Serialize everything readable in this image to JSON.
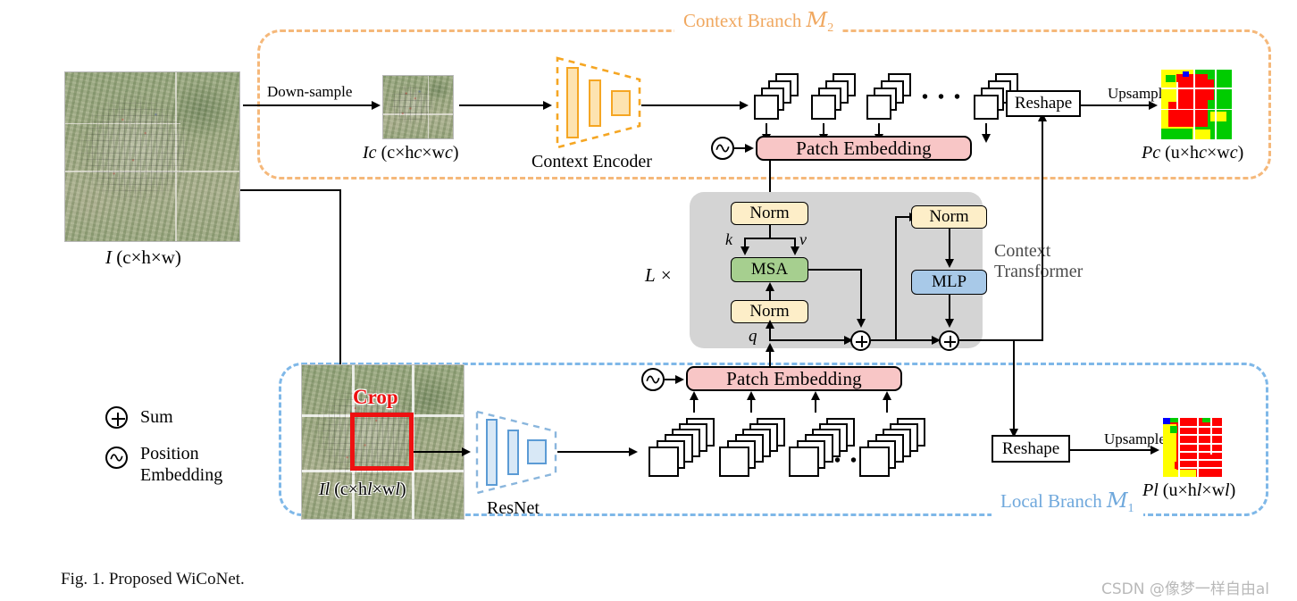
{
  "figure": {
    "caption": "Fig. 1.    Proposed WiCoNet.",
    "watermark": "CSDN @像梦一样自由al"
  },
  "branches": {
    "context": {
      "title_text": "Context Branch ",
      "title_symbol": "M",
      "title_sub": "2",
      "color": "#f0a860"
    },
    "local": {
      "title_text": "Local Branch ",
      "title_symbol": "M",
      "title_sub": "1",
      "color": "#6fa8dc"
    }
  },
  "inputs": {
    "main_image_label": "I (c×h×w)",
    "context_image_label": "I",
    "context_image_sub": "c",
    "context_image_dims": " (c×h",
    "context_image_dims2": "×w",
    "context_image_dims3": ")",
    "local_image_label": "I",
    "local_image_sub": "l",
    "downsample_label": "Down-sample",
    "crop_label": "Crop"
  },
  "encoders": {
    "context_encoder_label": "Context Encoder",
    "resnet_label": "ResNet"
  },
  "modules": {
    "patch_embedding_label": "Patch Embedding",
    "reshape_label": "Reshape",
    "upsample_label": "Upsample",
    "norm_label": "Norm",
    "msa_label": "MSA",
    "mlp_label": "MLP",
    "transformer_label_line1": "Context",
    "transformer_label_line2": "Transformer",
    "repeat_label": "L ×",
    "q_label": "q",
    "k_label": "k",
    "v_label": "v",
    "ellipsis": "• • •"
  },
  "outputs": {
    "context_pred_label": "P",
    "context_pred_sub": "c",
    "context_pred_dims": " (u×h",
    "local_pred_label": "P",
    "local_pred_sub": "l"
  },
  "formulas": {
    "I_main": {
      "sym": "I",
      "rest": " (c×h×w)"
    },
    "I_c": {
      "sym": "I",
      "sub": "c",
      "p1": " (c×h",
      "sub2": "c",
      "p2": "×w",
      "sub3": "c",
      "p3": ")"
    },
    "I_l": {
      "sym": "I",
      "sub": "l",
      "p1": " (c×h",
      "sub2": "l",
      "p2": "×w",
      "sub3": "l",
      "p3": ")"
    },
    "P_c": {
      "sym": "P",
      "sub": "c",
      "p1": " (u×h",
      "sub2": "c",
      "p2": "×w",
      "sub3": "c",
      "p3": ")"
    },
    "P_l": {
      "sym": "P",
      "sub": "l",
      "p1": " (u×h",
      "sub2": "l",
      "p2": "×w",
      "sub3": "l",
      "p3": ")"
    }
  },
  "legend": [
    {
      "icon": "sum-icon",
      "symbol": "+",
      "label": "Sum"
    },
    {
      "icon": "position-embedding-icon",
      "symbol": "~",
      "label_line1": "Position",
      "label_line2": "Embedding"
    }
  ],
  "colors": {
    "context_accent": "#f0a860",
    "local_accent": "#7fb8e8",
    "patch_embedding_fill": "#f8c6c6",
    "norm_fill": "#fdeec8",
    "msa_fill": "#a6cf8f",
    "mlp_fill": "#a8c9e8",
    "transformer_panel_fill": "#d4d4d4",
    "crop_box": "#ee1111",
    "seg_red": "#ff0000",
    "seg_yellow": "#ffff00",
    "seg_green": "#00cc00",
    "seg_blue": "#0000ff"
  }
}
